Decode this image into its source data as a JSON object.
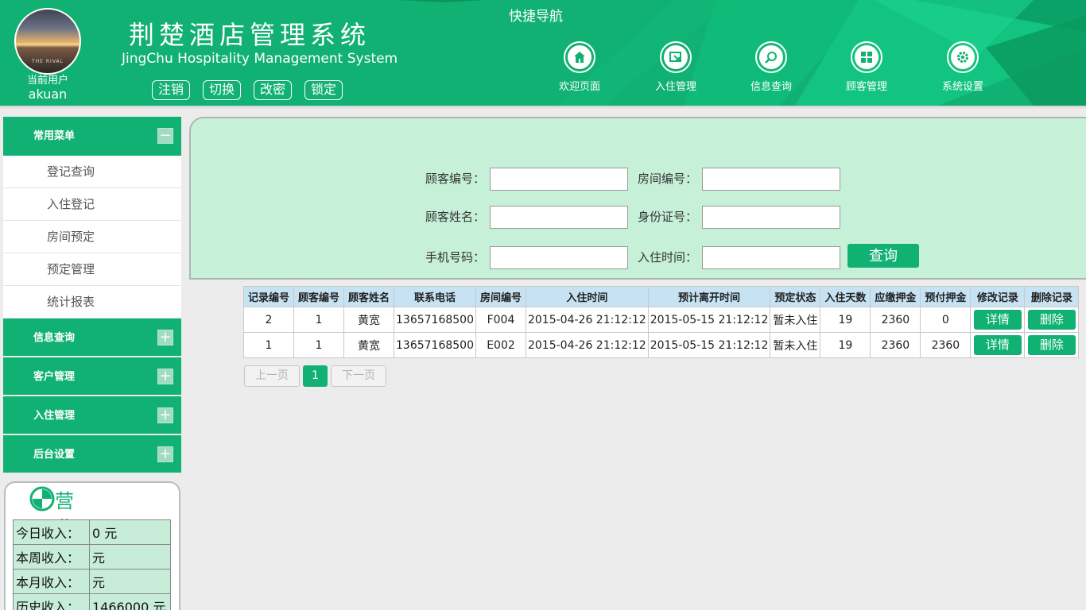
{
  "header": {
    "title_cn": "荆楚酒店管理系统",
    "title_en": "JingChu Hospitality Management System",
    "avatar_caption": "THE RIVAL",
    "current_user_label": "当前用户",
    "current_user": "akuan",
    "user_buttons": [
      "注销",
      "切换",
      "改密",
      "锁定"
    ],
    "quick_nav_title": "快捷导航",
    "nav": [
      {
        "label": "欢迎页面",
        "icon": "home-icon"
      },
      {
        "label": "入住管理",
        "icon": "checkin-icon"
      },
      {
        "label": "信息查询",
        "icon": "search-icon"
      },
      {
        "label": "顾客管理",
        "icon": "grid-icon"
      },
      {
        "label": "系统设置",
        "icon": "gear-icon"
      }
    ]
  },
  "sidebar": {
    "common_menu": "常用菜单",
    "common_items": [
      "登记查询",
      "入住登记",
      "房间预定",
      "预定管理",
      "统计报表"
    ],
    "sections": [
      "信息查询",
      "客户管理",
      "入住管理",
      "后台设置"
    ],
    "collapse_symbol": "−",
    "expand_symbol": "+"
  },
  "stats": {
    "title": "营业额统计",
    "rows": [
      {
        "label": "今日收入：",
        "value": "0 元"
      },
      {
        "label": "本周收入：",
        "value": "元"
      },
      {
        "label": "本月收入：",
        "value": "元"
      },
      {
        "label": "历史收入：",
        "value": "1466000 元"
      }
    ]
  },
  "search_form": {
    "customer_id_label": "顾客编号：",
    "room_id_label": "房间编号：",
    "customer_name_label": "顾客姓名：",
    "id_card_label": "身份证号：",
    "phone_label": "手机号码：",
    "checkin_time_label": "入住时间：",
    "query_button": "查询"
  },
  "table": {
    "headers": [
      "记录编号",
      "顾客编号",
      "顾客姓名",
      "联系电话",
      "房间编号",
      "入住时间",
      "预计离开时间",
      "预定状态",
      "入住天数",
      "应缴押金",
      "预付押金",
      "修改记录",
      "删除记录"
    ],
    "rows": [
      [
        "2",
        "1",
        "黄宽",
        "13657168500",
        "F004",
        "2015-04-26 21:12:12",
        "2015-05-15 21:12:12",
        "暂未入住",
        "19",
        "2360",
        "0"
      ],
      [
        "1",
        "1",
        "黄宽",
        "13657168500",
        "E002",
        "2015-04-26 21:12:12",
        "2015-05-15 21:12:12",
        "暂未入住",
        "19",
        "2360",
        "2360"
      ]
    ],
    "detail_button": "详情",
    "delete_button": "删除"
  },
  "pager": {
    "prev": "上一页",
    "current": "1",
    "next": "下一页"
  },
  "colors": {
    "primary": "#11b173",
    "panel": "#c6f0d8",
    "table_header": "#c7e3f3"
  }
}
